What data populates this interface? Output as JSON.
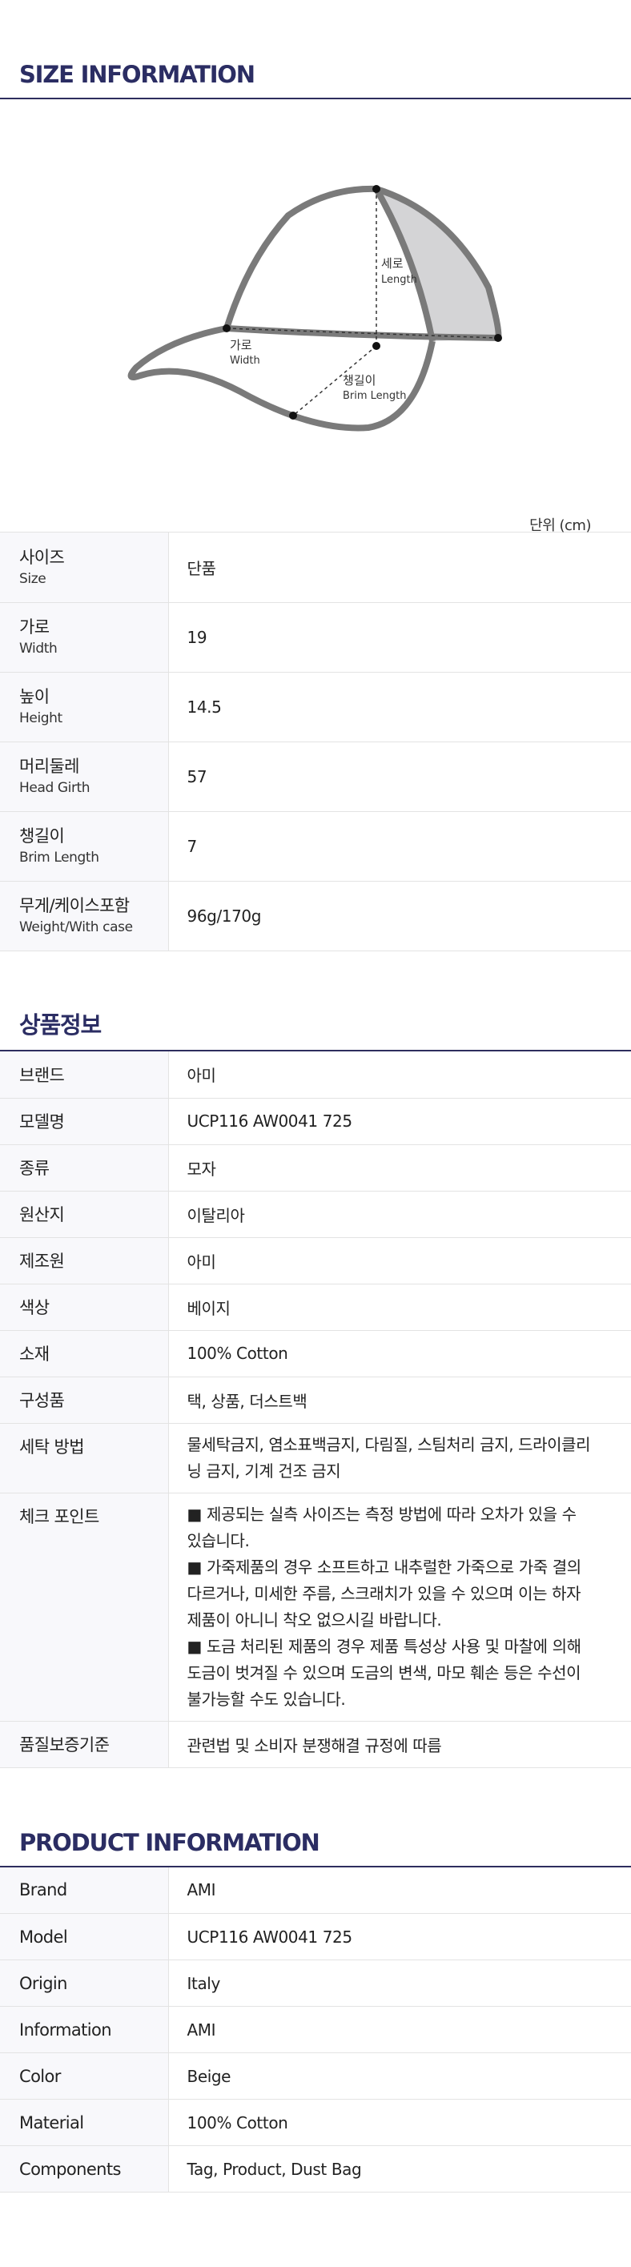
{
  "size_section": {
    "title": "SIZE INFORMATION",
    "diagram_labels": {
      "height_ko": "세로",
      "height_en": "Length",
      "width_ko": "가로",
      "width_en": "Width",
      "brim_ko": "챙길이",
      "brim_en": "Brim Length"
    },
    "unit": "단위 (cm)",
    "rows": [
      {
        "label_ko": "사이즈",
        "label_en": "Size",
        "value": "단품"
      },
      {
        "label_ko": "가로",
        "label_en": "Width",
        "value": "19"
      },
      {
        "label_ko": "높이",
        "label_en": "Height",
        "value": "14.5"
      },
      {
        "label_ko": "머리둘레",
        "label_en": "Head Girth",
        "value": "57"
      },
      {
        "label_ko": "챙길이",
        "label_en": "Brim Length",
        "value": "7"
      },
      {
        "label_ko": "무게/케이스포함",
        "label_en": "Weight/With case",
        "value": "96g/170g"
      }
    ]
  },
  "product_ko": {
    "title": "상품정보",
    "rows": [
      {
        "label": "브랜드",
        "value": "아미"
      },
      {
        "label": "모델명",
        "value": "UCP116 AW0041 725"
      },
      {
        "label": "종류",
        "value": "모자"
      },
      {
        "label": "원산지",
        "value": "이탈리아"
      },
      {
        "label": "제조원",
        "value": "아미"
      },
      {
        "label": "색상",
        "value": "베이지"
      },
      {
        "label": "소재",
        "value": "100% Cotton"
      },
      {
        "label": "구성품",
        "value": "택, 상품, 더스트백"
      },
      {
        "label": "세탁 방법",
        "value_lines": [
          "물세탁금지, 염소표백금지, 다림질, 스팀처리 금지, 드라이클리",
          "닝 금지, 기계 건조 금지"
        ]
      },
      {
        "label": "체크 포인트",
        "value_lines": [
          " ■ 제공되는 실측 사이즈는 측정 방법에 따라 오차가 있을 수",
          "있습니다.",
          " ■ 가죽제품의 경우 소프트하고 내추럴한 가죽으로 가죽 결의",
          "다르거나, 미세한 주름, 스크래치가 있을 수 있으며 이는 하자",
          "제품이 아니니 착오 없으시길 바랍니다.",
          " ■ 도금 처리된 제품의 경우 제품 특성상 사용 및 마찰에 의해",
          "도금이 벗겨질 수 있으며 도금의 변색, 마모 훼손 등은 수선이",
          "불가능할 수도 있습니다."
        ]
      },
      {
        "label": "품질보증기준",
        "value": "관련법 및 소비자 분쟁해결 규정에 따름"
      }
    ]
  },
  "product_en": {
    "title": "PRODUCT INFORMATION",
    "rows": [
      {
        "label": "Brand",
        "value": "AMI"
      },
      {
        "label": "Model",
        "value": "UCP116 AW0041 725"
      },
      {
        "label": "Origin",
        "value": "Italy"
      },
      {
        "label": "Information",
        "value": "AMI"
      },
      {
        "label": "Color",
        "value": "Beige"
      },
      {
        "label": "Material",
        "value": "100% Cotton"
      },
      {
        "label": "Components",
        "value": "Tag, Product, Dust Bag"
      }
    ]
  },
  "colors": {
    "title": "#2b2d63",
    "cap_outline": "#7a7a7a",
    "cap_side_fill": "#d4d4d6",
    "label_bg": "#f8f8fb"
  }
}
